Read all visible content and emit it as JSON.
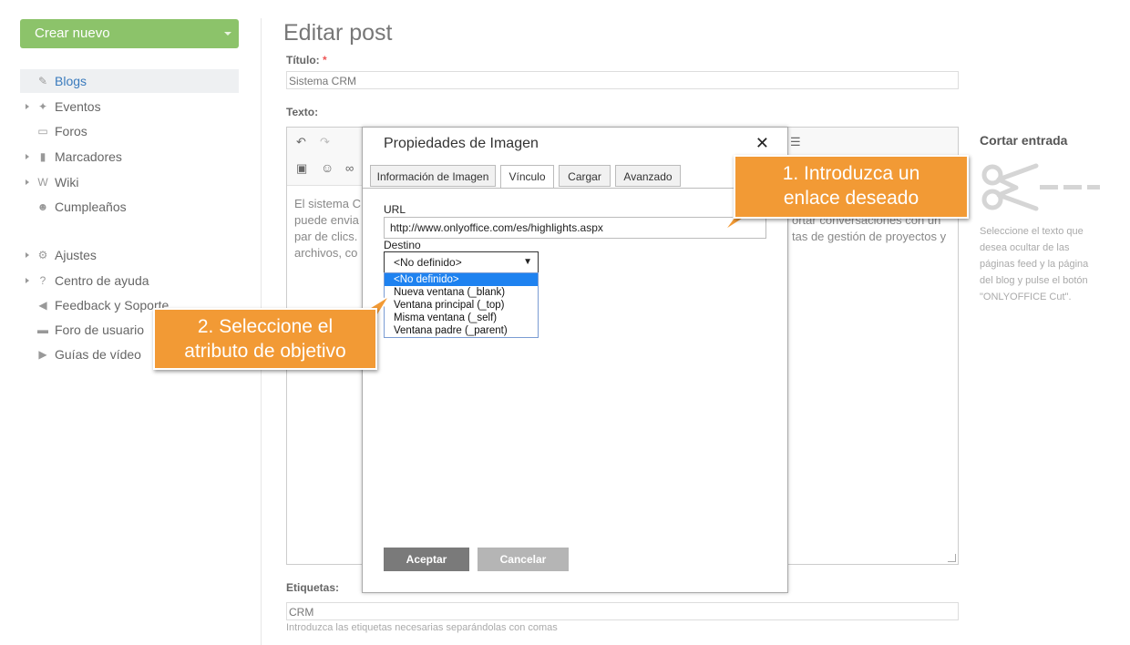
{
  "sidebar": {
    "new_button": "Crear nuevo",
    "items": [
      {
        "label": "Blogs",
        "icon": "edit-icon",
        "glyph": "✎"
      },
      {
        "label": "Eventos",
        "icon": "pin-icon",
        "glyph": "✦"
      },
      {
        "label": "Foros",
        "icon": "chat-icon",
        "glyph": "▭"
      },
      {
        "label": "Marcadores",
        "icon": "bookmark-icon",
        "glyph": "▮"
      },
      {
        "label": "Wiki",
        "icon": "wiki-icon",
        "glyph": "W"
      },
      {
        "label": "Cumpleaños",
        "icon": "people-icon",
        "glyph": "☻"
      },
      {
        "label": "Ajustes",
        "icon": "gear-icon",
        "glyph": "⚙"
      },
      {
        "label": "Centro de ayuda",
        "icon": "question-icon",
        "glyph": "?"
      },
      {
        "label": "Feedback y Soporte",
        "icon": "megaphone-icon",
        "glyph": "◀"
      },
      {
        "label": "Foro de usuario",
        "icon": "speech-icon",
        "glyph": "▬"
      },
      {
        "label": "Guías de vídeo",
        "icon": "video-icon",
        "glyph": "▶"
      }
    ]
  },
  "main": {
    "title": "Editar post",
    "title_label": "Título:",
    "required_mark": "*",
    "title_value": "Sistema CRM",
    "text_label": "Texto:",
    "editor_text_left": "El sistema C\npuede envia\npar de clics.\narchivos, co",
    "editor_text_right": "ortar conversaciones con un\ntas de gestión de proyectos y",
    "tags_label": "Etiquetas:",
    "tags_value": "CRM",
    "tags_hint": "Introduzca las etiquetas necesarias separándolas con comas"
  },
  "cut": {
    "title": "Cortar entrada",
    "description": "Seleccione el texto que\ndesea ocultar de las\npáginas feed y la página\ndel blog y pulse el botón\n\"ONLYOFFICE Cut\"."
  },
  "dialog": {
    "title": "Propiedades de Imagen",
    "close": "✕",
    "tabs": [
      "Información de Imagen",
      "Vínculo",
      "Cargar",
      "Avanzado"
    ],
    "active_tab": "Vínculo",
    "url_label": "URL",
    "url_value": "http://www.onlyoffice.com/es/highlights.aspx",
    "target_label": "Destino",
    "target_selected": "<No definido>",
    "target_options": [
      "<No definido>",
      "Nueva ventana (_blank)",
      "Ventana principal (_top)",
      "Misma ventana (_self)",
      "Ventana padre (_parent)"
    ],
    "ok": "Aceptar",
    "cancel": "Cancelar"
  },
  "callouts": {
    "step1": "1. Introduzca un\nenlace deseado",
    "step2": "2. Seleccione el\natributo de objetivo"
  },
  "colors": {
    "accent_green": "#8cc36a",
    "callout_orange": "#f29a35",
    "selection_blue": "#1e82f0",
    "ok_button": "#7a7a7a",
    "cancel_button": "#b5b5b5"
  }
}
